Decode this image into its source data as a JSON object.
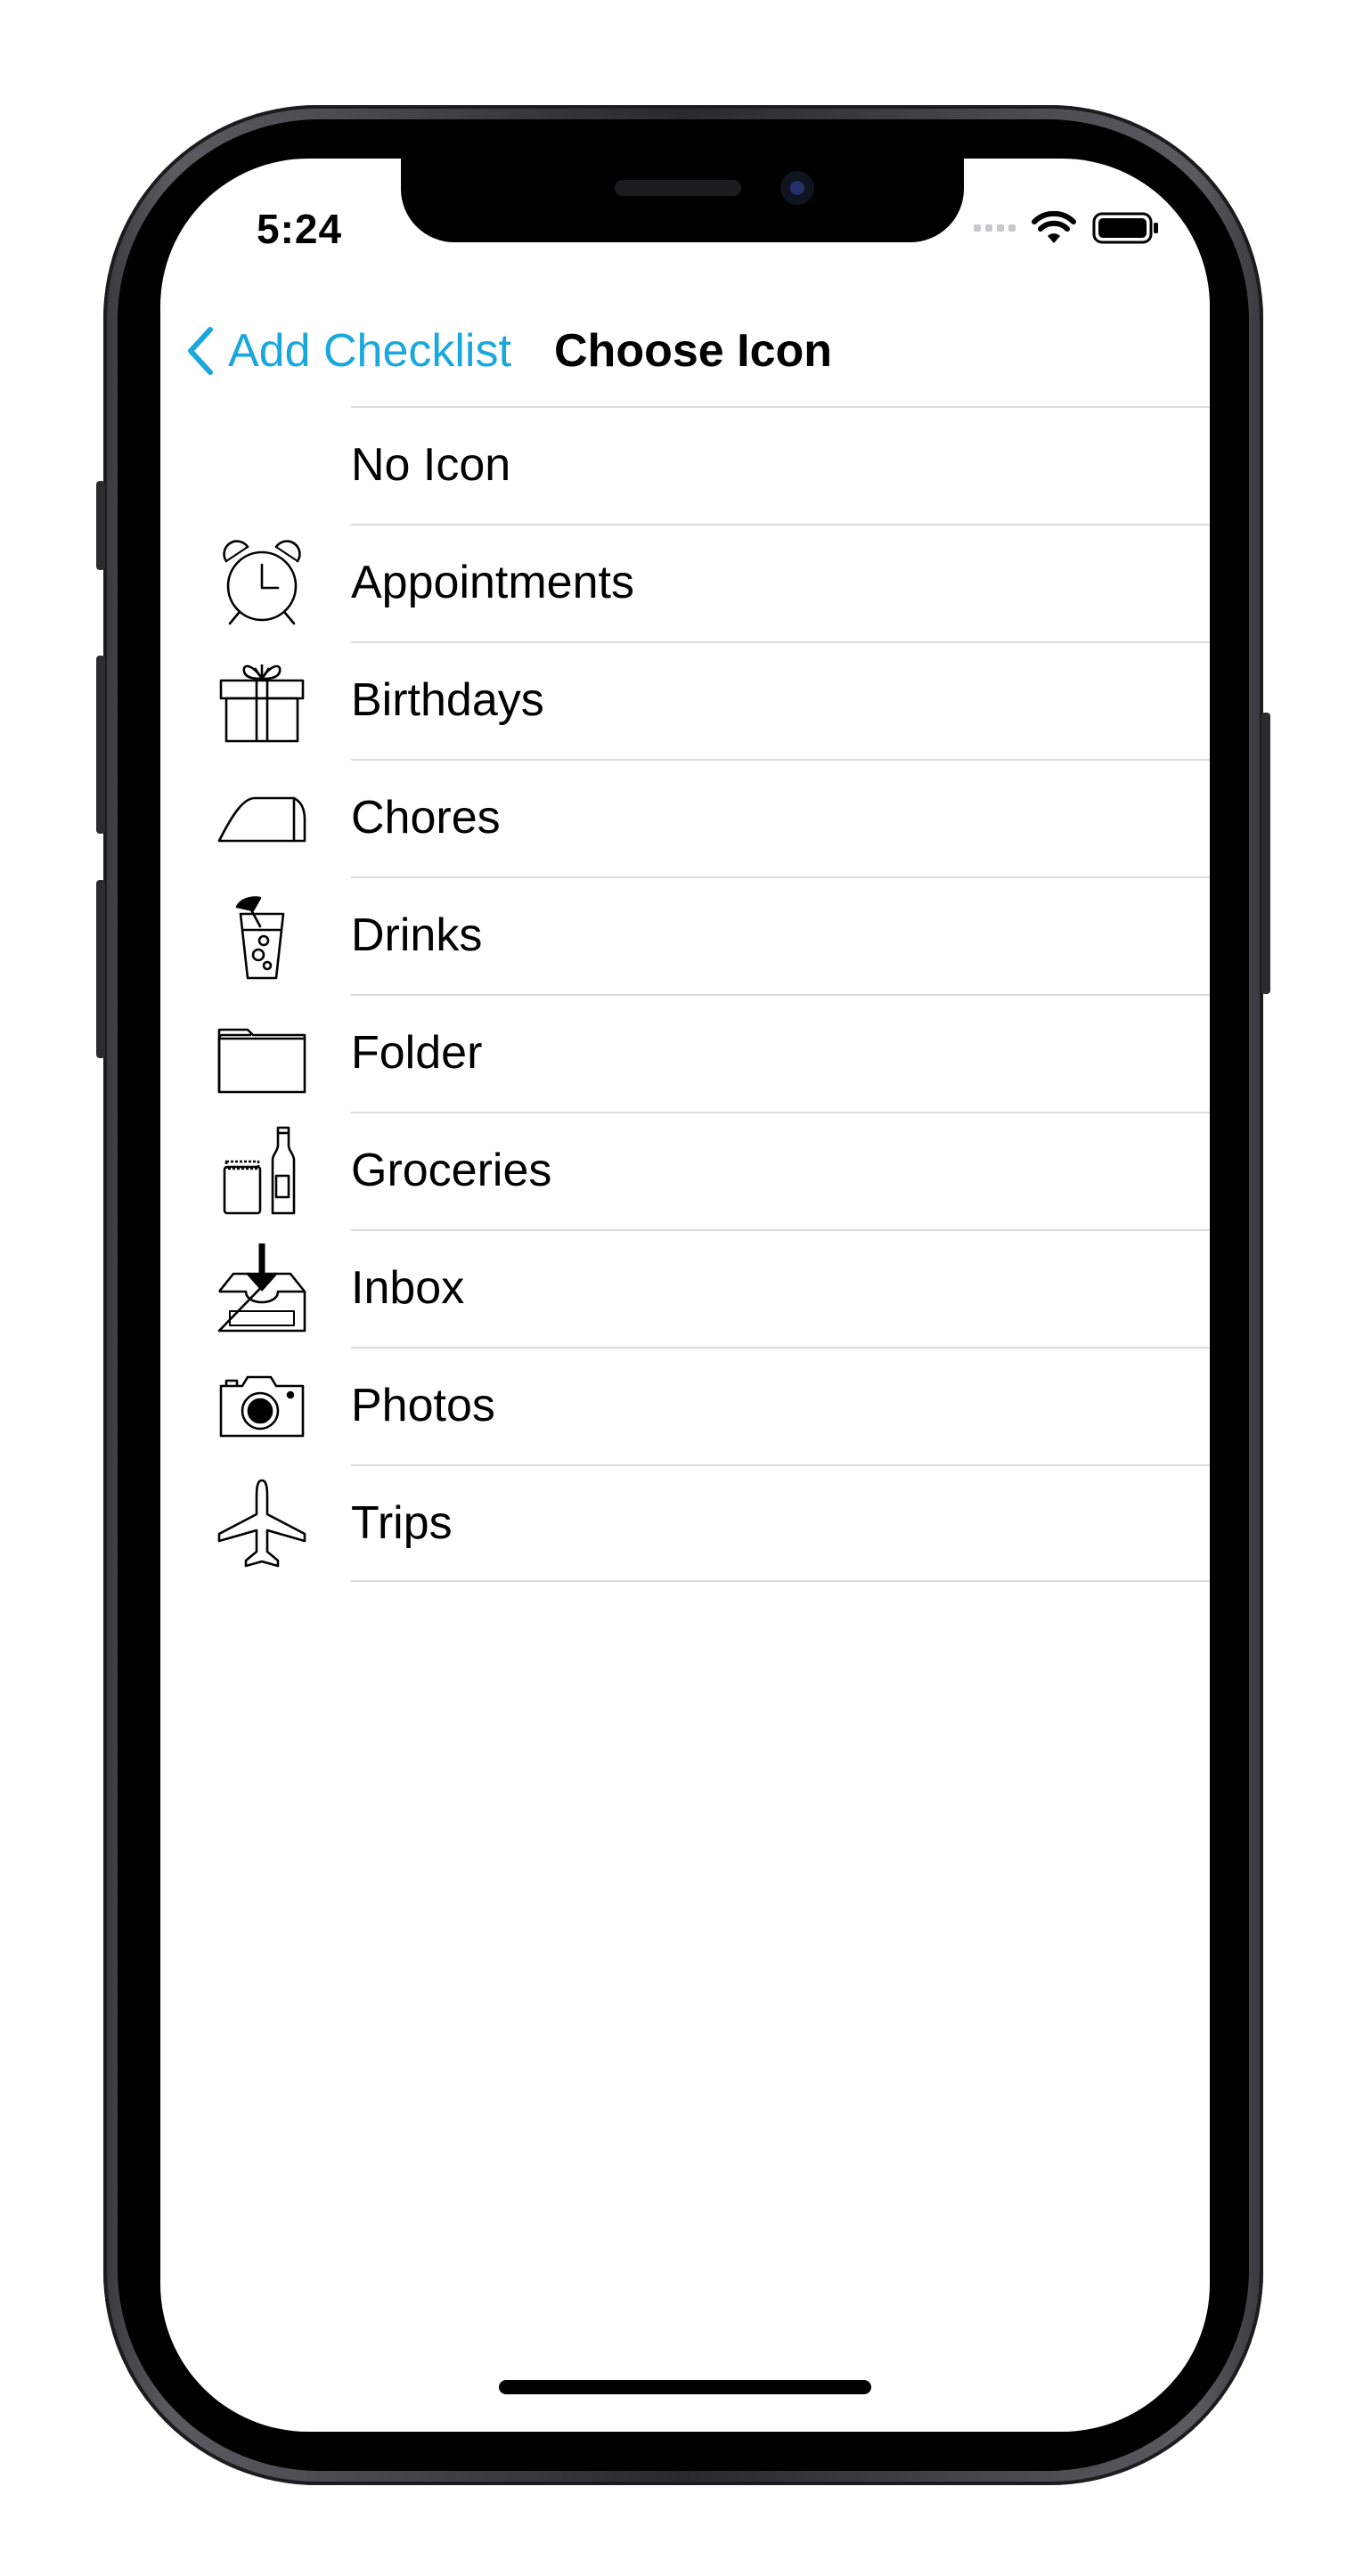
{
  "status_bar": {
    "time": "5:24"
  },
  "nav": {
    "back_label": "Add Checklist",
    "title": "Choose Icon",
    "accent_color": "#1aa7dc"
  },
  "icons": [
    {
      "label": "No Icon",
      "icon": "none"
    },
    {
      "label": "Appointments",
      "icon": "alarm-clock-icon"
    },
    {
      "label": "Birthdays",
      "icon": "gift-icon"
    },
    {
      "label": "Chores",
      "icon": "iron-icon"
    },
    {
      "label": "Drinks",
      "icon": "cocktail-glass-icon"
    },
    {
      "label": "Folder",
      "icon": "folder-icon"
    },
    {
      "label": "Groceries",
      "icon": "jar-and-bottle-icon"
    },
    {
      "label": "Inbox",
      "icon": "inbox-tray-icon"
    },
    {
      "label": "Photos",
      "icon": "camera-icon"
    },
    {
      "label": "Trips",
      "icon": "airplane-icon"
    }
  ]
}
